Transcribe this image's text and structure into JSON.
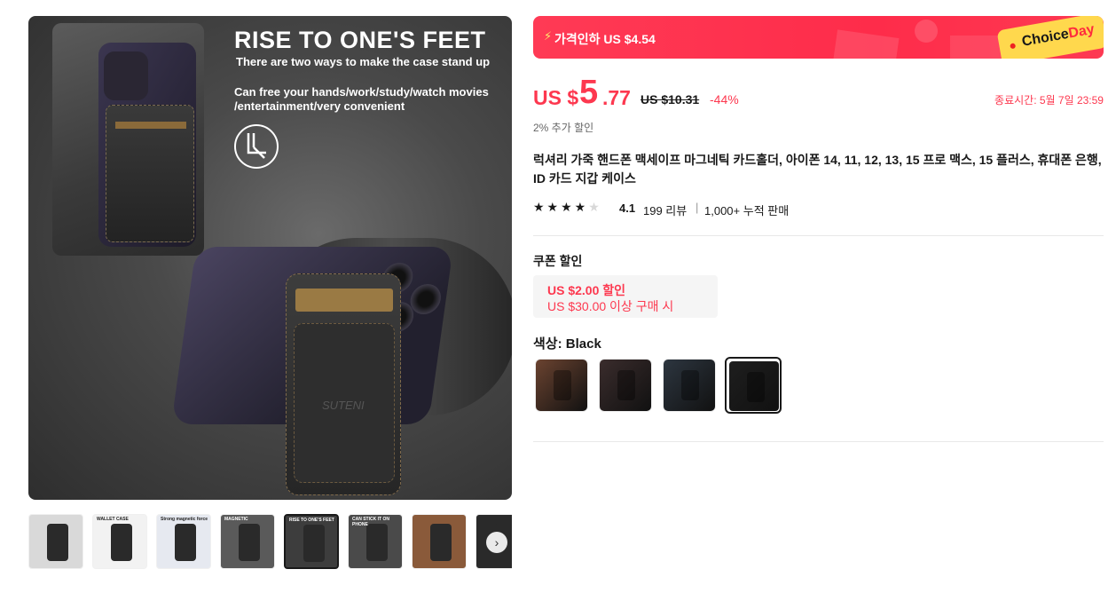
{
  "gallery": {
    "headline": "RISE TO ONE'S FEET",
    "sub1": "There are two ways to make the case stand up",
    "sub2": "Can free your hands/work/study/watch movies /entertainment/very convenient",
    "brand": "SUTENI",
    "thumbnails": [
      {
        "label": "",
        "bg": "#d9d9d9"
      },
      {
        "label": "WALLET CASE",
        "bg": "#f2f2f2"
      },
      {
        "label": "Strong magnetic force",
        "bg": "#e6e9f0"
      },
      {
        "label": "MAGNETIC",
        "bg": "#5a5a5a"
      },
      {
        "label": "RISE TO ONE'S FEET",
        "bg": "#3d3d3d"
      },
      {
        "label": "CAN STICK IT ON PHONE",
        "bg": "#4a4a4a"
      },
      {
        "label": "",
        "bg": "#8a5a3a"
      },
      {
        "label": "",
        "bg": "#2a2a2a"
      }
    ],
    "next_icon": "chevron-right-icon",
    "next_glyph": "›"
  },
  "banner": {
    "bolt": "⚡",
    "text": "가격인하 US $4.54",
    "choice_main": "Choice",
    "choice_accent": "Day",
    "color": "#fe2c4a"
  },
  "price": {
    "currency": "US $",
    "int": "5",
    "dec": ".77",
    "original": "US $10.31",
    "discount": "-44%",
    "end_time": "종료시간: 5월 7일 23:59",
    "extra_discount": "2% 추가 할인",
    "accent_color": "#fd384f"
  },
  "product": {
    "title": "럭셔리 가죽 핸드폰 맥세이프 마그네틱 카드홀더, 아이폰 14, 11, 12, 13, 15 프로 맥스, 15 플러스, 휴대폰 은행, ID 카드 지갑 케이스",
    "stars_filled": "★★★★",
    "stars_empty": "★",
    "rating": "4.1",
    "reviews": "199 리뷰",
    "separator": "|",
    "sold": "1,000+ 누적 판매"
  },
  "coupon": {
    "label": "쿠폰 할인",
    "line1": "US $2.00 할인",
    "line2": "US $30.00 이상 구매 시"
  },
  "color": {
    "label": "색상: Black",
    "options": [
      {
        "name": "Brown",
        "bg": "#6b4330"
      },
      {
        "name": "Dark Brown",
        "bg": "#3a2c2c"
      },
      {
        "name": "Blue",
        "bg": "#2d3640"
      },
      {
        "name": "Black",
        "bg": "#1e1e1e"
      }
    ]
  }
}
